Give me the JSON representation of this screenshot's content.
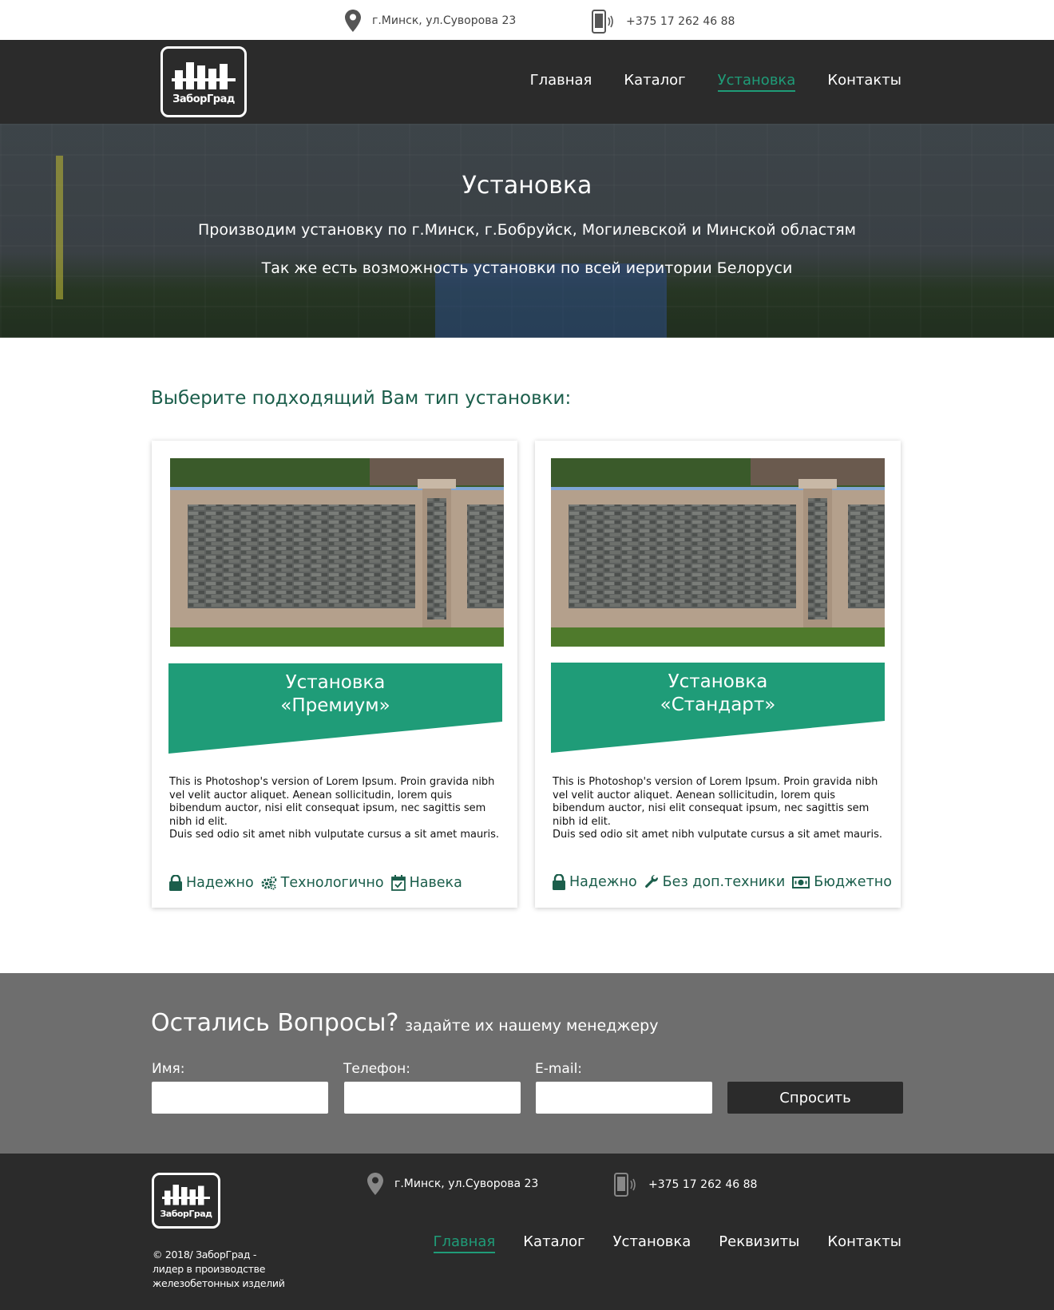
{
  "topbar": {
    "address": "г.Минск, ул.Суворова 23",
    "phone": "+375 17 262 46 88"
  },
  "header": {
    "logo_text": "ЗаборГрад",
    "nav": [
      "Главная",
      "Каталог",
      "Установка",
      "Контакты"
    ],
    "active_nav": "Установка"
  },
  "hero": {
    "title": "Установка",
    "line1": "Производим установку по г.Минск, г.Бобруйск, Могилевской и Минской областям",
    "line2": "Так же есть возможность установки по всей иеритории Белоруси"
  },
  "section": {
    "title": "Выберите подходящий Вам тип установки:"
  },
  "cards": [
    {
      "title_line1": "Установка",
      "title_line2": "«Премиум»",
      "description": "This is Photoshop's version  of Lorem Ipsum. Proin gravida nibh vel velit auctor aliquet. Aenean sollicitudin, lorem quis bibendum auctor, nisi elit consequat ipsum, nec sagittis sem nibh id elit.\nDuis sed odio sit amet nibh vulputate cursus a sit amet mauris.",
      "features": [
        {
          "icon": "lock-icon",
          "label": "Надежно"
        },
        {
          "icon": "gears-icon",
          "label": "Технологично"
        },
        {
          "icon": "calendar-check-icon",
          "label": "Навека"
        }
      ]
    },
    {
      "title_line1": "Установка",
      "title_line2": "«Стандарт»",
      "description": "This is Photoshop's version  of Lorem Ipsum. Proin gravida nibh vel velit auctor aliquet. Aenean sollicitudin, lorem quis bibendum auctor, nisi elit consequat ipsum, nec sagittis sem nibh id elit.\nDuis sed odio sit amet nibh vulputate cursus a sit amet mauris.",
      "features": [
        {
          "icon": "lock-icon",
          "label": "Надежно"
        },
        {
          "icon": "wrench-icon",
          "label": "Без доп.техники"
        },
        {
          "icon": "money-icon",
          "label": "Бюджетно"
        }
      ]
    }
  ],
  "questions": {
    "title": "Остались Вопросы?",
    "subtitle": "задайте их нашему менеджеру",
    "name_label": "Имя:",
    "phone_label": "Телефон:",
    "email_label": "E-mail:",
    "name_value": "",
    "phone_value": "",
    "email_value": "",
    "button": "Спросить"
  },
  "footer": {
    "logo_text": "ЗаборГрад",
    "copyright": "© 2018/ ЗаборГрад - лидер в производстве железобетонных изделий",
    "address": "г.Минск, ул.Суворова 23",
    "phone": "+375 17 262 46 88",
    "nav": [
      "Главная",
      "Каталог",
      "Установка",
      "Реквизиты",
      "Контакты"
    ],
    "active_nav": "Главная"
  },
  "colors": {
    "accent": "#1f9c78",
    "heading_green": "#1b5e4b",
    "dark": "#2b2b2b",
    "questions_bg": "#6e6e6e"
  }
}
